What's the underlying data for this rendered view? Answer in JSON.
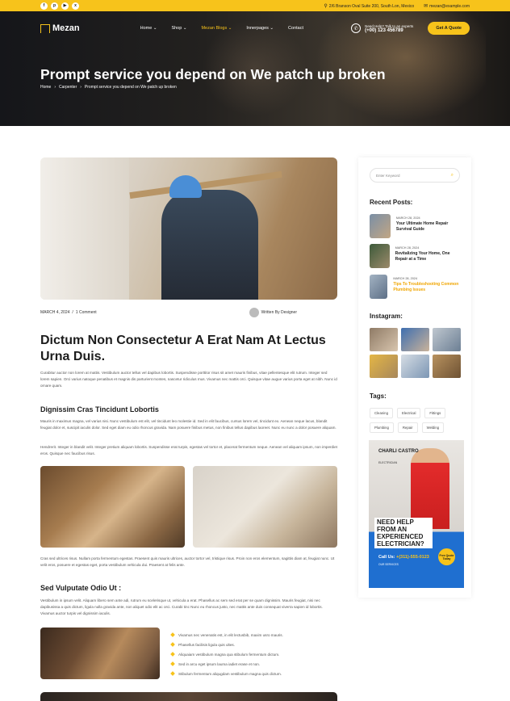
{
  "topbar": {
    "socials": [
      "f",
      "p",
      "▶",
      "x"
    ],
    "address": "2/6 Branson Oval Suite 200, South Lon, Mexico",
    "email": "mezan@example.com"
  },
  "nav": {
    "logo": "Mezan",
    "menu": [
      "Home",
      "Shop",
      "Mezan Blogs",
      "Innerpages",
      "Contact"
    ],
    "help_label": "Need Help? Talk to an experts",
    "help_phone": "(+00) 123 456789",
    "cta": "Get A Quote"
  },
  "hero": {
    "title": "Prompt service you depend on We patch up broken",
    "breadcrumb": [
      "Home",
      "Carpenter",
      "Prompt service you depend on We patch up broken"
    ]
  },
  "article": {
    "date": "MARCH 4, 2024",
    "comments": "1 Comment",
    "author": "Written By Designer",
    "title": "Dictum Non Consectetur A Erat Nam At Lectus Urna Duis.",
    "intro": "Curabitur auctor non lorem at mattis. Vestibulum auctor tellus vel dapibus lobortis. Suspendisse porttitor risus sit amet mauris finibus, vitae pellentesque elit rutrum. Integer sed lorem sapien. Orci varius natoque penatibus et magnis dis parturient montes, nascetur ridiculus mus. Vivamus nec mattis orci. Quisque vitae augue varius porta eget at nibh. Nunc id ornare quam.",
    "h2_1": "Dignissim Cras Tincidunt Lobortis",
    "p2": "Mauris in maximus magna, vel varius nisi. Nunc vestibulum est elit, vel tincidunt leo molestie id. Sed in elit faucibus, cursus lorem vel, tincidunt ex. Aenean neque lacus, blandit feugiat dolor et, suscipit iaculis dolor. Sed eget diam eu odio rhoncus gravida. Nam posuere finibus metus, non finibus tellus dapibus laoreet. Nunc eu nunc a dolor posuere aliquam.",
    "p3": "Hendrerit. Integer in blandit velit. Integer pretium aliquam lobortis. Suspendisse erat turpis, egestas vel tortor et, placerat fermentum neque. Aenean vel aliquam ipsum, non imperdiet eros. Quisque nec faucibus risus.",
    "p4": "Cras sed ultrices risus. Nullam porta fermentum egestas. Praesent quis mauris ultrices, auctor tortor vel, tristique risus. Proin non eros elementum, sagittis diam at, feugiat nunc. Ut velit eros, posuere et egestas eget, porta vestibulum vehicula dui. Praesent at felis ante.",
    "h2_2": "Sed Vulputate Odio Ut :",
    "p5": "Vestibulum in ipsum velit. Aliquam libero sem ante adi, rutrum eu scelerisque ut, vehicula a erat. Phasellus ac sem sed erat per se quam dignissim. Mauris feugiat, nisi nec dapibusissa a quis dictum, ligula nulla gravida ante, non aliquet odio elit ac orci. Curabi tinc Nunc eu rhoncus justo, nec mattis ante duis consequat viverra sapien id lobortis. Vivamus auctor turpis vel dignissim iaculis.",
    "bullets": [
      "Vivamus nec venenatis est, in elit lectusbib, maxim usro mauris.",
      "Phasellus facilisis ligula quis ultes.",
      "Aliquaiam vestibulum magna qua stibulum fermentum dictum.",
      "Sed in arcu eget ipsum lauma iadiet erase et non.",
      "Stibulum fermentum aliqugdam vestibulum magna quis dictum."
    ]
  },
  "sidebar": {
    "search_placeholder": "Enter Keyword",
    "recent_title": "Recent Posts:",
    "posts": [
      {
        "date": "MARCH 28, 2024",
        "title": "Your Ultimate Home Repair Survival Guide"
      },
      {
        "date": "MARCH 28, 2024",
        "title": "Revitalizing Your Home, One Repair at a Time"
      },
      {
        "date": "MARCH 28, 2024",
        "title": "Tips To Troubleshooting Common Plumbing Issues"
      }
    ],
    "instagram_title": "Instagram:",
    "tags_title": "Tags:",
    "tags": [
      "Cleaning",
      "Electrical",
      "Fittings",
      "Plumbing",
      "Repair",
      "Welding"
    ],
    "banner": {
      "name": "CHARLI CASTRO",
      "role": "ELECTRICIAN",
      "headline": "NEED HELP FROM AN EXPERIENCED ELECTRICIAN?",
      "call_label": "Call Us:",
      "call_number": "+(311)-555-0123",
      "services": "OUR SERVICES",
      "badge": "Free Quote Today"
    }
  },
  "colors": {
    "accent": "#f7c31b",
    "dark": "#1c1c1c",
    "banner_blue": "#1f6fd0"
  }
}
